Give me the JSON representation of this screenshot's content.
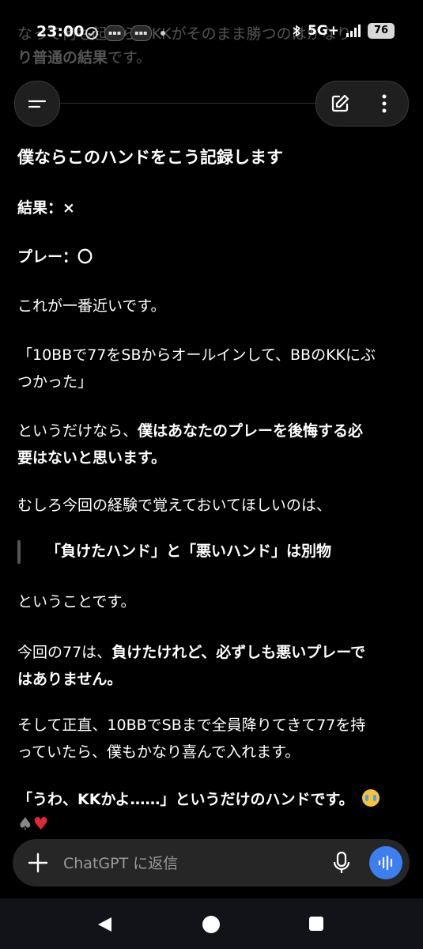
{
  "status_bar": {
    "time": "23:00",
    "network": "5G+",
    "battery": "76"
  },
  "background_text": {
    "line1": "なって何も起こらずKKがそのまま勝つのはかなり",
    "line2_bold": "り普通の結果",
    "line2_rest": "です。"
  },
  "message": {
    "heading": "僕ならこのハンドをこう記録します",
    "result": "結果：×",
    "play": "プレー：〇",
    "p1": "これが一番近いです。",
    "p2_line1": "「10BBで77をSBからオールインして、BBのKKにぶ",
    "p2_line2": "つかった」",
    "p3_line1_plain": "というだけなら、",
    "p3_line1_bold": "僕はあなたのプレーを後悔する必",
    "p3_line2_bold": "要はないと思います。",
    "p4": "むしろ今回の経験で覚えておいてほしいのは、",
    "quote": "「負けたハンド」と「悪いハンド」は別物",
    "p5": "ということです。",
    "p6_line1_plain": "今回の77は、",
    "p6_line1_bold": "負けたけれど、必ずしも悪いプレーで",
    "p6_line2_bold": "はありません。",
    "p7_line1": "そして正直、10BBでSBまで全員降りてきて77を持",
    "p7_line2": "っていたら、僕もかなり喜んで入れます。",
    "p8_bold": "「うわ、KKかよ……」",
    "p8_plain": "というだけのハンドです。",
    "suits": {
      "spade": "♠",
      "heart": "♥"
    }
  },
  "composer": {
    "placeholder": "ChatGPT に返信"
  },
  "colors": {
    "accent": "#3d7ff0",
    "background": "#000000",
    "surface": "#262626"
  },
  "icons": {
    "menu": "menu-icon",
    "edit": "pencil-icon",
    "more": "more-vertical-icon",
    "plus": "plus-icon",
    "mic": "mic-icon",
    "voice": "voice-wave-icon"
  }
}
